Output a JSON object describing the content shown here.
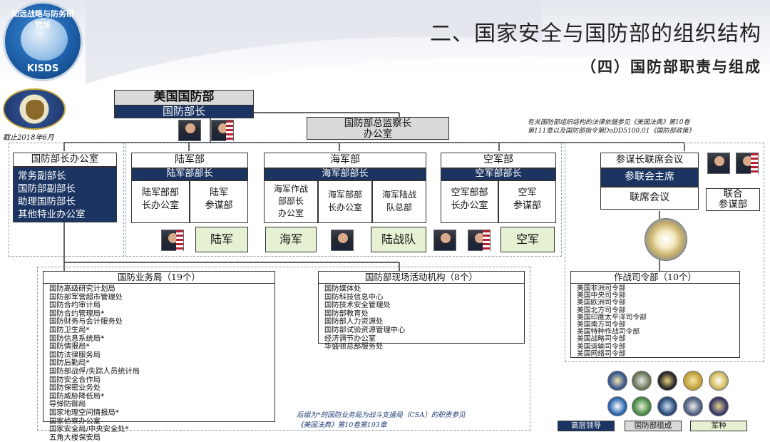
{
  "header": {
    "title": "二、国家安全与国防部的组织结构",
    "subtitle": "（四）国防部职责与组成",
    "logo_text": "KISDS",
    "logo_ring_text": "知远战略与防务研究所"
  },
  "date_note": "截止2018年6月",
  "legal_note": {
    "line1": "有关国防部组织结构的法律依据参见《美国法典》第10卷",
    "line2": "第111章以及国防部指令第DoDD5100.01《国防部政策》"
  },
  "dod": {
    "name": "美国国防部",
    "head": "国防部长"
  },
  "inspector_general": {
    "line1": "国防部总监察长",
    "line2": "办公室"
  },
  "osd": {
    "title": "国防部长办公室",
    "items": [
      "常务副部长",
      "国防部副部长",
      "助理国防部长",
      "其他特业办公室"
    ]
  },
  "army": {
    "title": "陆军部",
    "head": "陆军部部长",
    "left": [
      "陆军部部",
      "长办公室"
    ],
    "right": [
      "陆军",
      "参谋部"
    ],
    "service": "陆军"
  },
  "navy": {
    "title": "海军部",
    "head": "海军部部长",
    "col1": [
      "海军作战",
      "部部长",
      "办公室"
    ],
    "col2": [
      "海军部部",
      "长办公室"
    ],
    "col3": [
      "海军陆战",
      "队总部"
    ],
    "service_navy": "海军",
    "service_marines": "陆战队"
  },
  "airforce": {
    "title": "空军部",
    "head": "空军部部长",
    "left": [
      "空军部部",
      "长办公室"
    ],
    "right": [
      "空军",
      "参谋部"
    ],
    "service": "空军"
  },
  "jcs": {
    "title": "参谋长联席会议",
    "chairman": "参联会主席",
    "meeting": "联席会议",
    "joint_staff": [
      "联合",
      "参谋部"
    ]
  },
  "agencies": {
    "header": "国防业务局（19个）",
    "items": [
      "国防高级研究计划局",
      "国防部军营超市管理处",
      "国防合约审计局",
      "国防合约管理局*",
      "国防财务与会计服务处",
      "国防卫生局*",
      "国防信息系统局*",
      "国防情报局*",
      "国防法律服务局",
      "国防后勤局*",
      "国防部战俘/失踪人员统计局",
      "国防安全合作局",
      "国防保密业务处",
      "国防威胁降低局*",
      "导弹防御局",
      "国家地理空间情报局*",
      "国家侦察办公室",
      "国家安全局/中央安全处*",
      "五角大楼保安局"
    ]
  },
  "field_activities": {
    "header": "国防部现场活动机构（8个）",
    "items": [
      "国防媒体处",
      "国防科技信息中心",
      "国防技术安全管理处",
      "国防部教育处",
      "国防部人力资源处",
      "国防部试验资源管理中心",
      "经济调节办公室",
      "华盛顿总部服务处"
    ]
  },
  "commands": {
    "header": "作战司令部（10个）",
    "items": [
      "美国非洲司令部",
      "美国中央司令部",
      "美国欧洲司令部",
      "美国北方司令部",
      "美国印度太平洋司令部",
      "美国南方司令部",
      "美国特种作战司令部",
      "美国战略司令部",
      "美国运输司令部",
      "美国网络司令部"
    ]
  },
  "csa_note": {
    "line1": "后缀为*的国防业务局为战斗支援局（CSA）的职责参见",
    "line2": "《美国法典》第10卷第193章"
  },
  "legend": {
    "senior": "高层领导",
    "components": "国防部组成",
    "services": "军种"
  },
  "colors": {
    "navy": "#1b3461",
    "gray": "#d9d9d9",
    "green": "#e6f0d2"
  }
}
